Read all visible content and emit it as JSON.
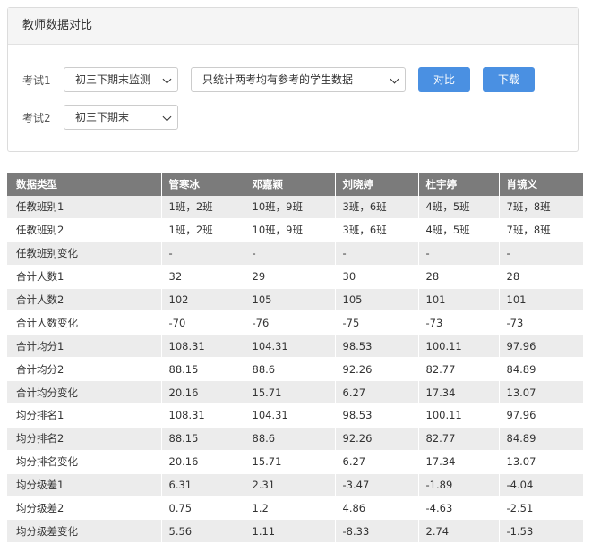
{
  "panel": {
    "title": "教师数据对比",
    "exam1_label": "考试1",
    "exam1_value": "初三下期末监测",
    "filter_value": "只统计两考均有参考的学生数据",
    "compare_label": "对比",
    "download_label": "下载",
    "exam2_label": "考试2",
    "exam2_value": "初三下期末"
  },
  "table": {
    "headers": [
      "数据类型",
      "管寒冰",
      "邓嘉颖",
      "刘晓婷",
      "杜宇婷",
      "肖镜义"
    ],
    "rows": [
      [
        "任教班别1",
        "1班，2班",
        "10班，9班",
        "3班，6班",
        "4班，5班",
        "7班，8班"
      ],
      [
        "任教班别2",
        "1班，2班",
        "10班，9班",
        "3班，6班",
        "4班，5班",
        "7班，8班"
      ],
      [
        "任教班别变化",
        "-",
        "-",
        "-",
        "-",
        "-"
      ],
      [
        "合计人数1",
        "32",
        "29",
        "30",
        "28",
        "28"
      ],
      [
        "合计人数2",
        "102",
        "105",
        "105",
        "101",
        "101"
      ],
      [
        "合计人数变化",
        "-70",
        "-76",
        "-75",
        "-73",
        "-73"
      ],
      [
        "合计均分1",
        "108.31",
        "104.31",
        "98.53",
        "100.11",
        "97.96"
      ],
      [
        "合计均分2",
        "88.15",
        "88.6",
        "92.26",
        "82.77",
        "84.89"
      ],
      [
        "合计均分变化",
        "20.16",
        "15.71",
        "6.27",
        "17.34",
        "13.07"
      ],
      [
        "均分排名1",
        "108.31",
        "104.31",
        "98.53",
        "100.11",
        "97.96"
      ],
      [
        "均分排名2",
        "88.15",
        "88.6",
        "92.26",
        "82.77",
        "84.89"
      ],
      [
        "均分排名变化",
        "20.16",
        "15.71",
        "6.27",
        "17.34",
        "13.07"
      ],
      [
        "均分级差1",
        "6.31",
        "2.31",
        "-3.47",
        "-1.89",
        "-4.04"
      ],
      [
        "均分级差2",
        "0.75",
        "1.2",
        "4.86",
        "-4.63",
        "-2.51"
      ],
      [
        "均分级差变化",
        "5.56",
        "1.11",
        "-8.33",
        "2.74",
        "-1.53"
      ]
    ]
  }
}
